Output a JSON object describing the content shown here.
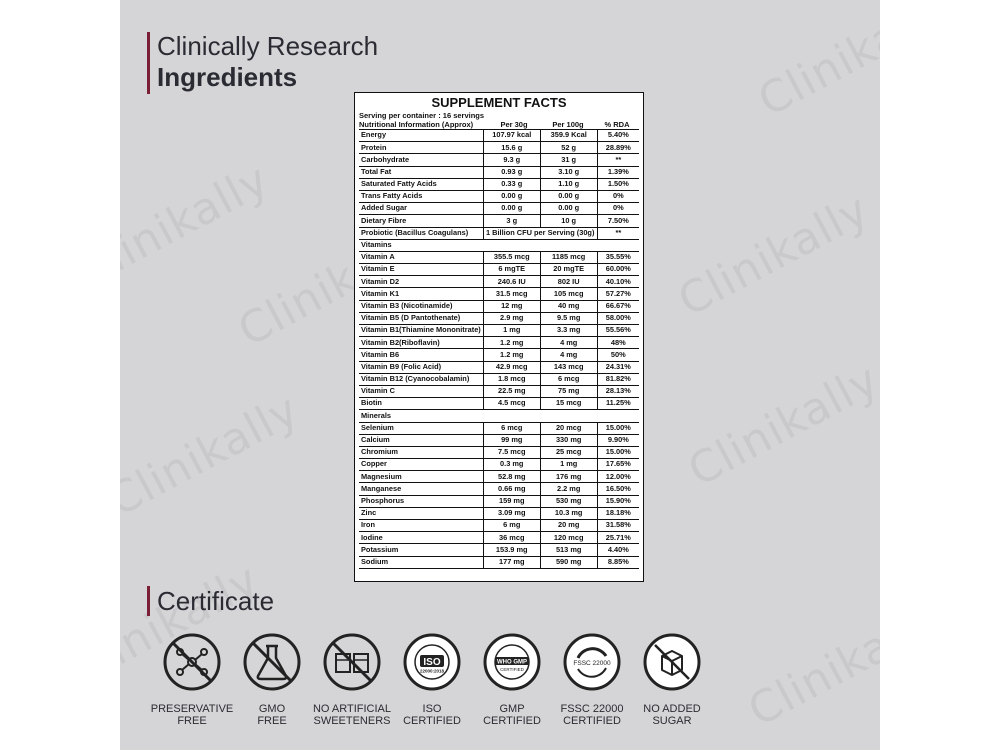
{
  "heading": {
    "line1": "Clinically Research",
    "line2": "Ingredients"
  },
  "supplement_facts": {
    "title": "SUPPLEMENT FACTS",
    "serving": "Serving per container : 16 servings",
    "info_label": "Nutritional Information (Approx)",
    "col_per30": "Per 30g",
    "col_per100": "Per 100g",
    "col_rda": "% RDA",
    "rows": [
      {
        "name": "Energy",
        "per30": "107.97 kcal",
        "per100": "359.9 Kcal",
        "rda": "5.40%"
      },
      {
        "name": "Protein",
        "per30": "15.6 g",
        "per100": "52 g",
        "rda": "28.89%"
      },
      {
        "name": "Carbohydrate",
        "per30": "9.3 g",
        "per100": "31 g",
        "rda": "**"
      },
      {
        "name": "Total Fat",
        "per30": "0.93 g",
        "per100": "3.10 g",
        "rda": "1.39%"
      },
      {
        "name": "Saturated Fatty Acids",
        "per30": "0.33 g",
        "per100": "1.10 g",
        "rda": "1.50%"
      },
      {
        "name": "Trans Fatty Acids",
        "per30": "0.00 g",
        "per100": "0.00 g",
        "rda": "0%"
      },
      {
        "name": "Added Sugar",
        "per30": "0.00 g",
        "per100": "0.00 g",
        "rda": "0%"
      },
      {
        "name": "Dietary Fibre",
        "per30": "3 g",
        "per100": "10 g",
        "rda": "7.50%"
      },
      {
        "name": "Probiotic (Bacillus Coagulans)",
        "span": "1 Billion CFU per Serving (30g)",
        "rda": "**"
      },
      {
        "section": "Vitamins"
      },
      {
        "name": "Vitamin A",
        "per30": "355.5 mcg",
        "per100": "1185 mcg",
        "rda": "35.55%"
      },
      {
        "name": "Vitamin E",
        "per30": "6 mgTE",
        "per100": "20 mgTE",
        "rda": "60.00%"
      },
      {
        "name": "Vitamin D2",
        "per30": "240.6 IU",
        "per100": "802 IU",
        "rda": "40.10%"
      },
      {
        "name": "Vitamin K1",
        "per30": "31.5 mcg",
        "per100": "105 mcg",
        "rda": "57.27%"
      },
      {
        "name": "Vitamin B3 (Nicotinamide)",
        "per30": "12 mg",
        "per100": "40 mg",
        "rda": "66.67%"
      },
      {
        "name": "Vitamin B5 (D Pantothenate)",
        "per30": "2.9 mg",
        "per100": "9.5 mg",
        "rda": "58.00%"
      },
      {
        "name": "Vitamin B1(Thiamine Mononitrate)",
        "per30": "1 mg",
        "per100": "3.3 mg",
        "rda": "55.56%"
      },
      {
        "name": "Vitamin B2(Riboflavin)",
        "per30": "1.2 mg",
        "per100": "4 mg",
        "rda": "48%"
      },
      {
        "name": "Vitamin B6",
        "per30": "1.2 mg",
        "per100": "4 mg",
        "rda": "50%"
      },
      {
        "name": "Vitamin B9 (Folic Acid)",
        "per30": "42.9 mcg",
        "per100": "143 mcg",
        "rda": "24.31%"
      },
      {
        "name": "Vitamin B12 (Cyanocobalamin)",
        "per30": "1.8 mcg",
        "per100": "6 mcg",
        "rda": "81.82%"
      },
      {
        "name": "Vitamin C",
        "per30": "22.5 mg",
        "per100": "75 mg",
        "rda": "28.13%"
      },
      {
        "name": "Biotin",
        "per30": "4.5 mcg",
        "per100": "15 mcg",
        "rda": "11.25%"
      },
      {
        "section": "Minerals"
      },
      {
        "name": "Selenium",
        "per30": "6 mcg",
        "per100": "20 mcg",
        "rda": "15.00%"
      },
      {
        "name": "Calcium",
        "per30": "99 mg",
        "per100": "330 mg",
        "rda": "9.90%"
      },
      {
        "name": "Chromium",
        "per30": "7.5 mcg",
        "per100": "25 mcg",
        "rda": "15.00%"
      },
      {
        "name": "Copper",
        "per30": "0.3 mg",
        "per100": "1 mg",
        "rda": "17.65%"
      },
      {
        "name": "Magnesium",
        "per30": "52.8 mg",
        "per100": "176 mg",
        "rda": "12.00%"
      },
      {
        "name": "Manganese",
        "per30": "0.66 mg",
        "per100": "2.2 mg",
        "rda": "16.50%"
      },
      {
        "name": "Phosphorus",
        "per30": "159 mg",
        "per100": "530 mg",
        "rda": "15.90%"
      },
      {
        "name": "Zinc",
        "per30": "3.09 mg",
        "per100": "10.3 mg",
        "rda": "18.18%"
      },
      {
        "name": "Iron",
        "per30": "6 mg",
        "per100": "20 mg",
        "rda": "31.58%"
      },
      {
        "name": "Iodine",
        "per30": "36 mcg",
        "per100": "120 mcg",
        "rda": "25.71%"
      },
      {
        "name": "Potassium",
        "per30": "153.9 mg",
        "per100": "513 mg",
        "rda": "4.40%"
      },
      {
        "name": "Sodium",
        "per30": "177 mg",
        "per100": "590 mg",
        "rda": "8.85%"
      }
    ]
  },
  "certificate_heading": "Certificate",
  "certificates": [
    {
      "icon": "preservative-free-icon",
      "line1": "PRESERVATIVE",
      "line2": "FREE"
    },
    {
      "icon": "gmo-free-icon",
      "line1": "GMO",
      "line2": "FREE"
    },
    {
      "icon": "no-artificial-sweeteners-icon",
      "line1": "NO ARTIFICIAL",
      "line2": "SWEETENERS"
    },
    {
      "icon": "iso-certified-icon",
      "line1": "ISO",
      "line2": "CERTIFIED",
      "seal_text": "ISO",
      "seal_sub": "22000:2018",
      "seal_ring": "FOOD SAFETY MANAGEMENT SYSTEM"
    },
    {
      "icon": "gmp-certified-icon",
      "line1": "GMP",
      "line2": "CERTIFIED",
      "seal_text": "WHO GMP",
      "seal_sub": "CERTIFIED",
      "seal_ring": "GOOD MANUFACTURING PRACTICE"
    },
    {
      "icon": "fssc-22000-icon",
      "line1": "FSSC 22000",
      "line2": "CERTIFIED",
      "seal_text": "FSSC 22000"
    },
    {
      "icon": "no-added-sugar-icon",
      "line1": "NO ADDED",
      "line2": "SUGAR"
    }
  ],
  "watermark": "Clinikally",
  "colors": {
    "accent": "#7a1f36",
    "panel": "#d5d5d7",
    "text": "#2b2b33"
  }
}
